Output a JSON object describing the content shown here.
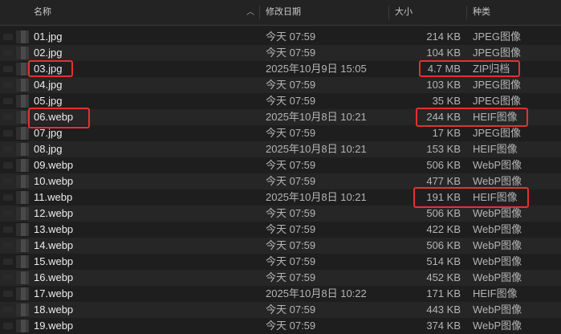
{
  "columns": {
    "name": "名称",
    "date": "修改日期",
    "size": "大小",
    "kind": "种类"
  },
  "sort_icon": "chevron-up-icon",
  "highlight_color": "#e53030",
  "files": [
    {
      "name": "01.jpg",
      "date": "今天 07:59",
      "size": "214 KB",
      "kind": "JPEG图像"
    },
    {
      "name": "02.jpg",
      "date": "今天 07:59",
      "size": "104 KB",
      "kind": "JPEG图像"
    },
    {
      "name": "03.jpg",
      "date": "2025年10月9日 15:05",
      "size": "4.7 MB",
      "kind": "ZIP归档"
    },
    {
      "name": "04.jpg",
      "date": "今天 07:59",
      "size": "103 KB",
      "kind": "JPEG图像"
    },
    {
      "name": "05.jpg",
      "date": "今天 07:59",
      "size": "35 KB",
      "kind": "JPEG图像"
    },
    {
      "name": "06.webp",
      "date": "2025年10月8日 10:21",
      "size": "244 KB",
      "kind": "HEIF图像"
    },
    {
      "name": "07.jpg",
      "date": "今天 07:59",
      "size": "17 KB",
      "kind": "JPEG图像"
    },
    {
      "name": "08.jpg",
      "date": "2025年10月8日 10:21",
      "size": "153 KB",
      "kind": "HEIF图像"
    },
    {
      "name": "09.webp",
      "date": "今天 07:59",
      "size": "506 KB",
      "kind": "WebP图像"
    },
    {
      "name": "10.webp",
      "date": "今天 07:59",
      "size": "477 KB",
      "kind": "WebP图像"
    },
    {
      "name": "11.webp",
      "date": "2025年10月8日 10:21",
      "size": "191 KB",
      "kind": "HEIF图像"
    },
    {
      "name": "12.webp",
      "date": "今天 07:59",
      "size": "506 KB",
      "kind": "WebP图像"
    },
    {
      "name": "13.webp",
      "date": "今天 07:59",
      "size": "422 KB",
      "kind": "WebP图像"
    },
    {
      "name": "14.webp",
      "date": "今天 07:59",
      "size": "506 KB",
      "kind": "WebP图像"
    },
    {
      "name": "15.webp",
      "date": "今天 07:59",
      "size": "514 KB",
      "kind": "WebP图像"
    },
    {
      "name": "16.webp",
      "date": "今天 07:59",
      "size": "452 KB",
      "kind": "WebP图像"
    },
    {
      "name": "17.webp",
      "date": "2025年10月8日 10:22",
      "size": "171 KB",
      "kind": "HEIF图像"
    },
    {
      "name": "18.webp",
      "date": "今天 07:59",
      "size": "443 KB",
      "kind": "WebP图像"
    },
    {
      "name": "19.webp",
      "date": "今天 07:59",
      "size": "374 KB",
      "kind": "WebP图像"
    }
  ]
}
